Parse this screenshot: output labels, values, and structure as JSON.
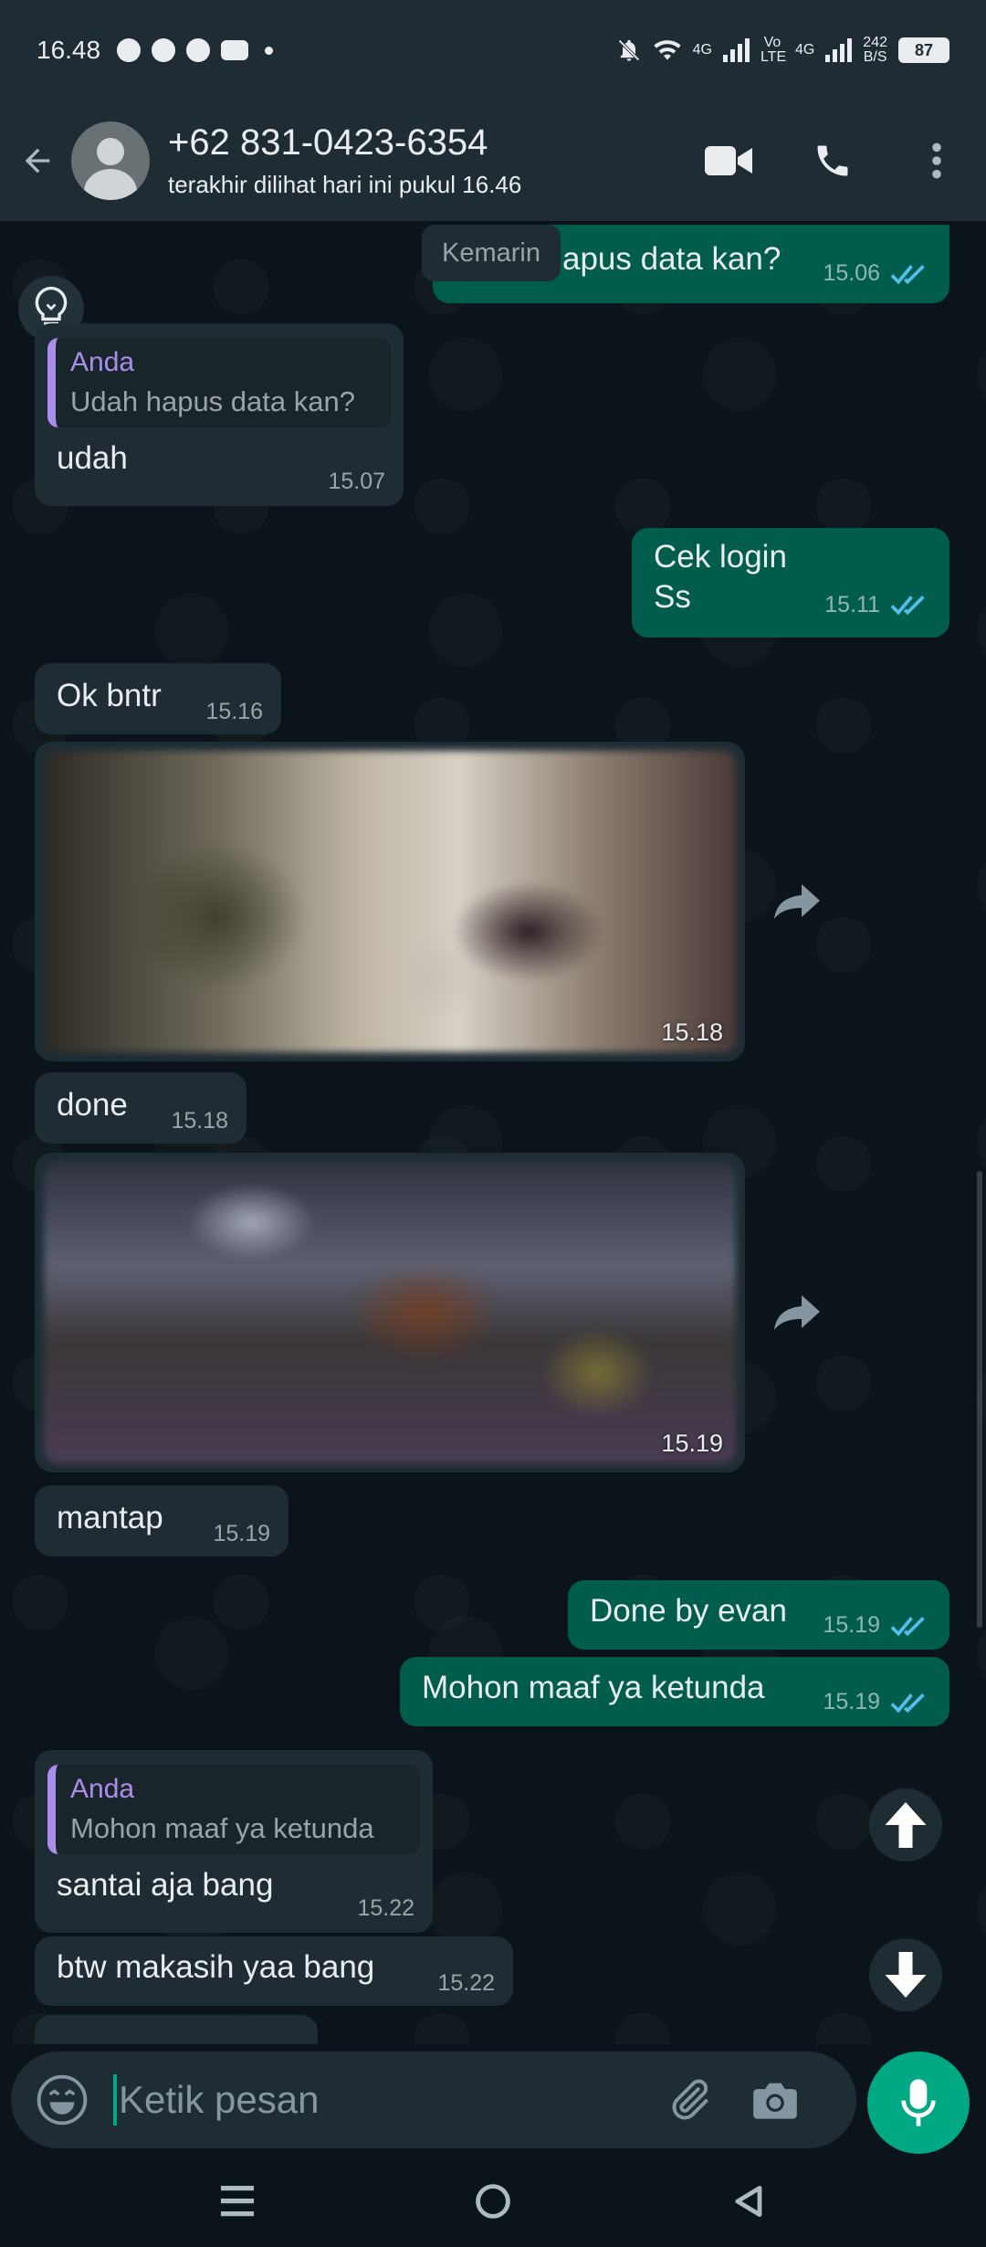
{
  "status_bar": {
    "time": "16.48",
    "net_4g_1": "4G",
    "volte": "Vo LTE",
    "net_4g_2": "4G",
    "speed_value": "242",
    "speed_unit": "B/S",
    "battery": "87"
  },
  "header": {
    "contact_name": "+62 831-0423-6354",
    "contact_status": "terakhir dilihat hari ini pukul 16.46"
  },
  "chat": {
    "date_chip": "Kemarin",
    "messages": [
      {
        "text": "apus data kan?",
        "time": "15.06"
      },
      {
        "quote_author": "Anda",
        "quote_text": "Udah hapus data kan?",
        "text": "udah",
        "time": "15.07"
      },
      {
        "text": "Cek login",
        "text2": "Ss",
        "time": "15.11"
      },
      {
        "text": "Ok bntr",
        "time": "15.16"
      },
      {
        "time": "15.18"
      },
      {
        "text": "done",
        "time": "15.18"
      },
      {
        "time": "15.19"
      },
      {
        "text": "mantap",
        "time": "15.19"
      },
      {
        "text": "Done by evan",
        "time": "15.19"
      },
      {
        "text": "Mohon maaf ya ketunda",
        "time": "15.19"
      },
      {
        "quote_author": "Anda",
        "quote_text": "Mohon maaf ya ketunda",
        "text": "santai aja bang",
        "time": "15.22"
      },
      {
        "text": "btw makasih yaa bang",
        "time": "15.22"
      }
    ]
  },
  "composer": {
    "placeholder": "Ketik pesan"
  },
  "colors": {
    "background": "#0b141a",
    "header": "#1f2c34",
    "incoming_bubble": "#1f2c34",
    "outgoing_bubble": "#005c4b",
    "accent": "#00a884",
    "read_ticks": "#53bdeb",
    "quote_author": "#a98fe9"
  },
  "icons": [
    "back-arrow-icon",
    "avatar-placeholder-icon",
    "video-call-icon",
    "phone-icon",
    "more-vert-icon",
    "bulb-icon",
    "double-check-icon",
    "forward-icon",
    "arrow-up-icon",
    "arrow-down-icon",
    "emoji-icon",
    "attach-icon",
    "camera-icon",
    "mic-icon",
    "nav-recents-icon",
    "nav-home-icon",
    "nav-back-icon"
  ]
}
